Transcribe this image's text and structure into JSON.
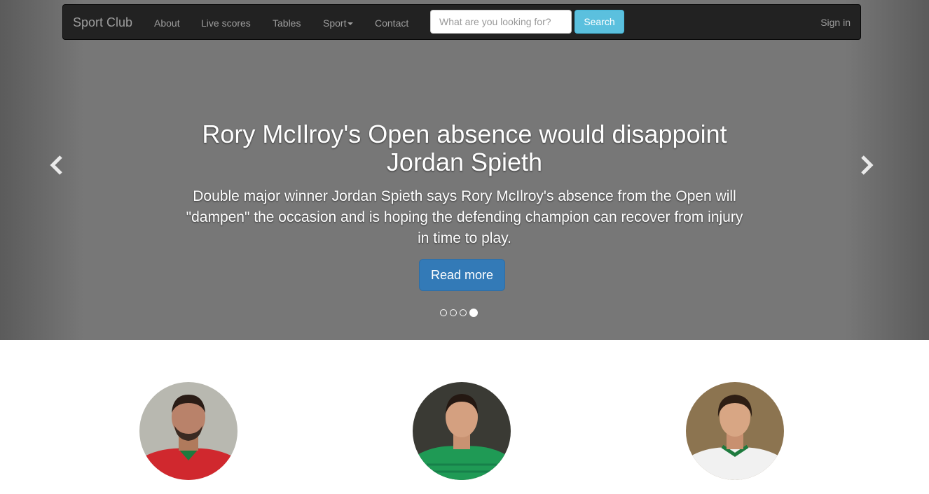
{
  "navbar": {
    "brand": "Sport Club",
    "links": [
      "About",
      "Live scores",
      "Tables",
      "Sport",
      "Contact"
    ],
    "search": {
      "placeholder": "What are you looking for?",
      "value": "",
      "button_label": "Search"
    },
    "signin_label": "Sign in"
  },
  "carousel": {
    "title": "Rory McIlroy's Open absence would disappoint Jordan Spieth",
    "description": "Double major winner Jordan Spieth says Rory McIlroy's absence from the Open will \"dampen\" the occasion and is hoping the defending champion can recover from injury in time to play.",
    "button_label": "Read more",
    "slide_count": 4,
    "active_slide": 4,
    "prev_icon": "chevron-left-icon",
    "next_icon": "chevron-right-icon"
  },
  "players": [
    {
      "kit_color": "#d0282e"
    },
    {
      "kit_color": "#1f9a55"
    },
    {
      "kit_color": "#f1f1f1"
    }
  ],
  "colors": {
    "navbar_bg": "#222222",
    "search_button": "#5bc0de",
    "primary_button": "#337ab7",
    "carousel_bg": "#777777"
  }
}
